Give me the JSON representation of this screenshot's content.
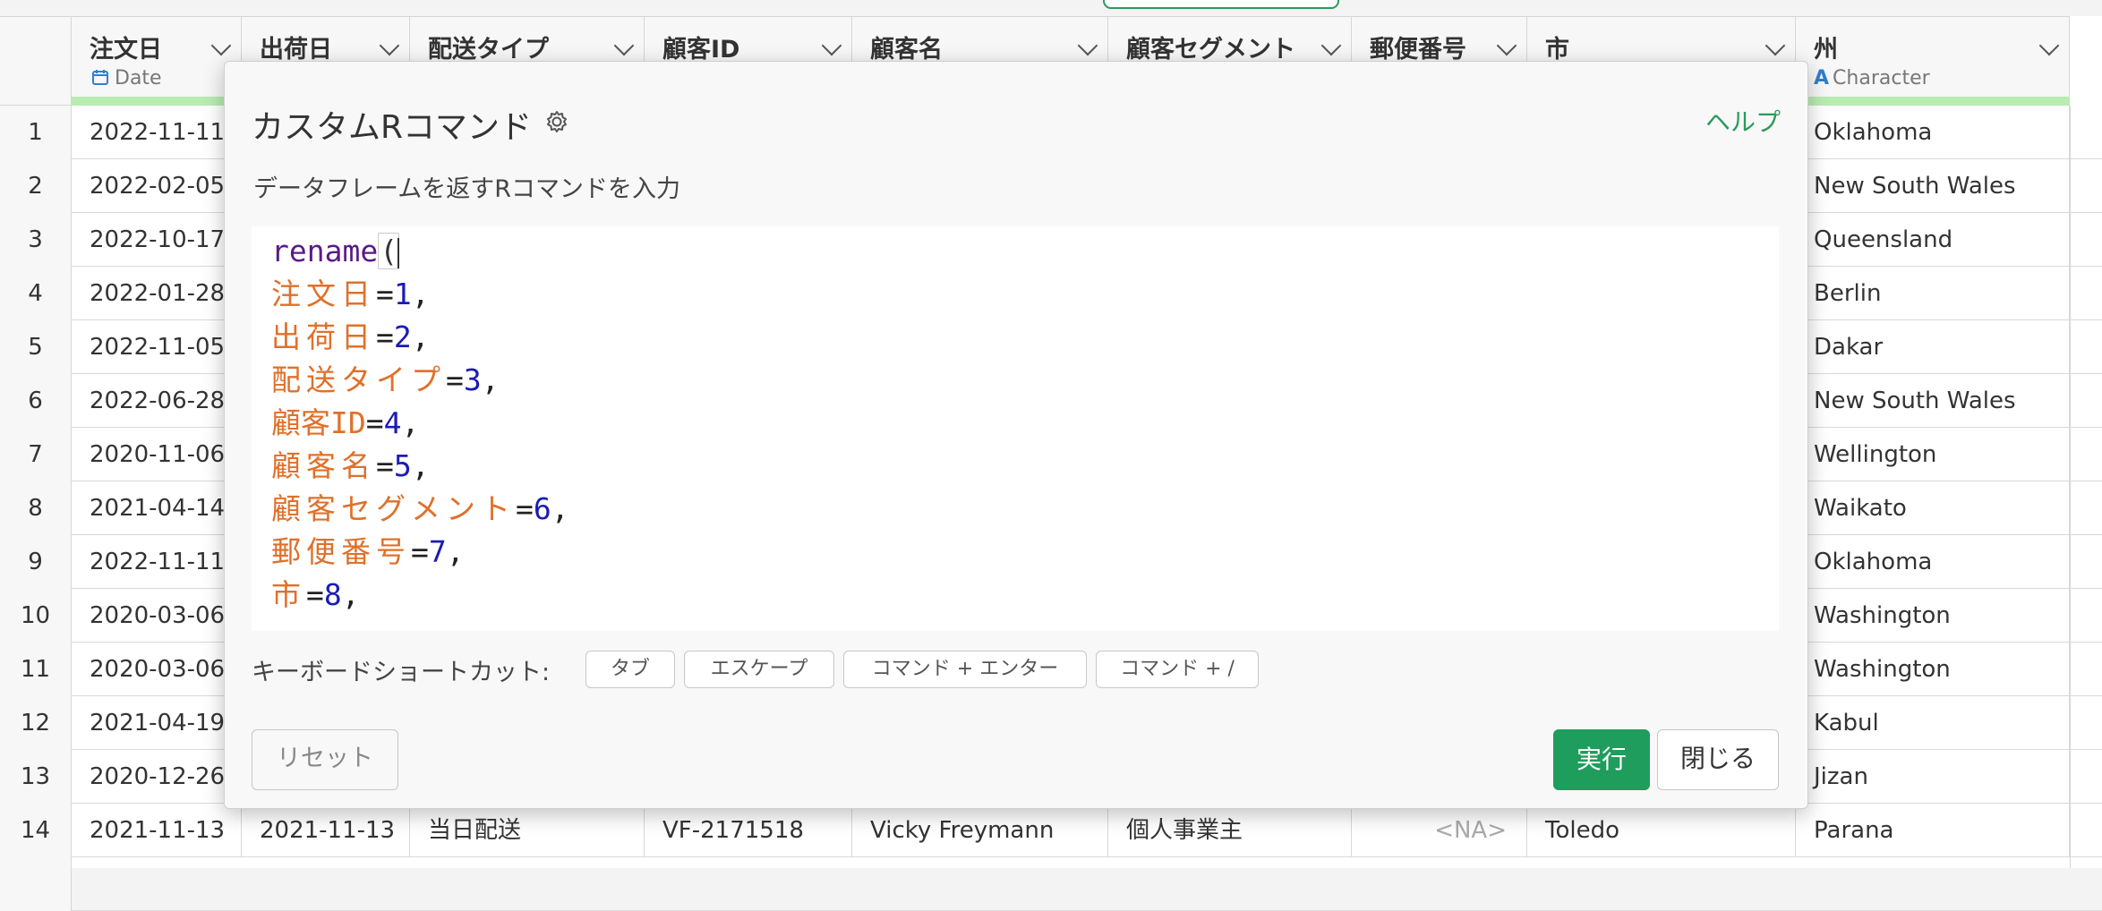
{
  "columns": [
    {
      "name": "注文日",
      "type": "Date",
      "type_icon": "calendar-icon"
    },
    {
      "name": "出荷日",
      "type": "",
      "type_icon": ""
    },
    {
      "name": "配送タイプ",
      "type": "",
      "type_icon": ""
    },
    {
      "name": "顧客ID",
      "type": "",
      "type_icon": ""
    },
    {
      "name": "顧客名",
      "type": "",
      "type_icon": ""
    },
    {
      "name": "顧客セグメント",
      "type": "",
      "type_icon": ""
    },
    {
      "name": "郵便番号",
      "type": "",
      "type_icon": ""
    },
    {
      "name": "市",
      "type": "",
      "type_icon": ""
    },
    {
      "name": "州",
      "type": "Character",
      "type_icon": "character-type-icon"
    }
  ],
  "rows": [
    {
      "num": "1",
      "order_date": "2022-11-11",
      "state": "Oklahoma"
    },
    {
      "num": "2",
      "order_date": "2022-02-05",
      "state": "New South Wales"
    },
    {
      "num": "3",
      "order_date": "2022-10-17",
      "state": "Queensland"
    },
    {
      "num": "4",
      "order_date": "2022-01-28",
      "state": "Berlin"
    },
    {
      "num": "5",
      "order_date": "2022-11-05",
      "state": "Dakar"
    },
    {
      "num": "6",
      "order_date": "2022-06-28",
      "state": "New South Wales"
    },
    {
      "num": "7",
      "order_date": "2020-11-06",
      "state": "Wellington"
    },
    {
      "num": "8",
      "order_date": "2021-04-14",
      "state": "Waikato"
    },
    {
      "num": "9",
      "order_date": "2022-11-11",
      "state": "Oklahoma"
    },
    {
      "num": "10",
      "order_date": "2020-03-06",
      "state": "Washington"
    },
    {
      "num": "11",
      "order_date": "2020-03-06",
      "state": "Washington"
    },
    {
      "num": "12",
      "order_date": "2021-04-19",
      "state": "Kabul"
    },
    {
      "num": "13",
      "order_date": "2020-12-26",
      "state": "Jizan"
    }
  ],
  "last_row": {
    "num": "14",
    "cells": [
      "2021-11-13",
      "2021-11-13",
      "当日配送",
      "VF-2171518",
      "Vicky Freymann",
      "個人事業主",
      "<NA>",
      "Toledo",
      "Parana"
    ]
  },
  "modal": {
    "title": "カスタムRコマンド",
    "gear_icon": "gear-icon",
    "help": "ヘルプ",
    "description": "データフレームを返すRコマンドを入力",
    "code": {
      "fn": "rename",
      "args": [
        {
          "key": "注文日",
          "value": "1"
        },
        {
          "key": "出荷日",
          "value": "2"
        },
        {
          "key": "配送タイプ",
          "value": "3"
        },
        {
          "key": "顧客ID",
          "value": "4"
        },
        {
          "key": "顧客名",
          "value": "5"
        },
        {
          "key": "顧客セグメント",
          "value": "6"
        },
        {
          "key": "郵便番号",
          "value": "7"
        },
        {
          "key": "市",
          "value": "8"
        }
      ]
    },
    "shortcuts_label": "キーボードショートカット:",
    "shortcuts": [
      "タブ",
      "エスケープ",
      "コマンド + エンター",
      "コマンド + /"
    ],
    "reset": "リセット",
    "run": "実行",
    "close": "閉じる"
  },
  "colors": {
    "accent": "#1f9d5c",
    "help_link": "#2a9b5b",
    "code_function": "#5a1b86",
    "code_key": "#e0702a",
    "code_number": "#1b1bb8",
    "type_strip": "#b8ecb1"
  }
}
